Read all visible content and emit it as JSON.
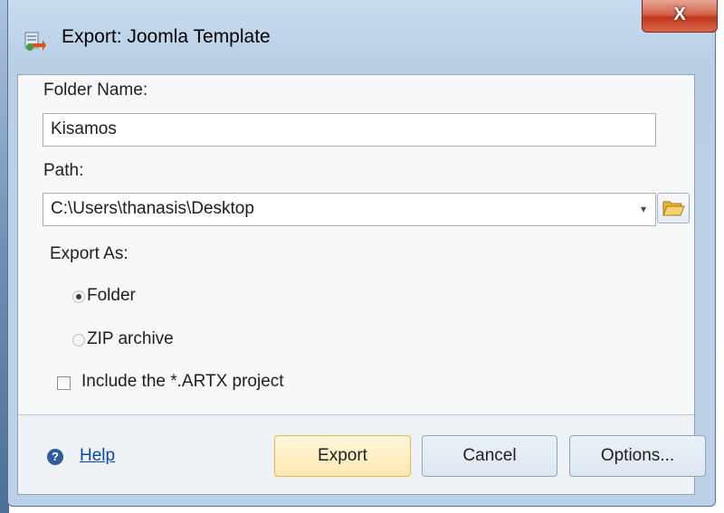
{
  "window": {
    "title": "Export: Joomla Template",
    "close_label": "X"
  },
  "form": {
    "folder_name_label": "Folder Name:",
    "folder_name_value": "Kisamos",
    "path_label": "Path:",
    "path_value": "C:\\Users\\thanasis\\Desktop",
    "export_as_label": "Export As:",
    "radio_options": [
      {
        "label": "Folder",
        "checked": true
      },
      {
        "label": "ZIP archive",
        "checked": false
      }
    ],
    "include_project_label": "Include the *.ARTX project",
    "include_project_checked": false
  },
  "footer": {
    "help_label": "Help",
    "export_label": "Export",
    "cancel_label": "Cancel",
    "options_label": "Options..."
  },
  "icons": {
    "app": "export-template-icon",
    "browse": "folder-open-icon",
    "help": "question-icon",
    "combo": "chevron-down-icon"
  }
}
